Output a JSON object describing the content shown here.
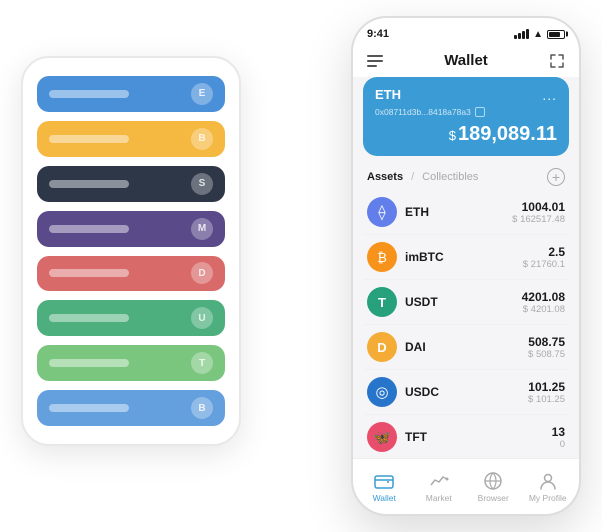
{
  "bg_phone": {
    "cards": [
      {
        "color": "card-blue",
        "label": "",
        "icon": "E"
      },
      {
        "color": "card-yellow",
        "label": "",
        "icon": "B"
      },
      {
        "color": "card-dark",
        "label": "",
        "icon": "S"
      },
      {
        "color": "card-purple",
        "label": "",
        "icon": "M"
      },
      {
        "color": "card-red",
        "label": "",
        "icon": "D"
      },
      {
        "color": "card-green",
        "label": "",
        "icon": "U"
      },
      {
        "color": "card-lightgreen",
        "label": "",
        "icon": "T"
      },
      {
        "color": "card-cornblue",
        "label": "",
        "icon": "B"
      }
    ]
  },
  "status_bar": {
    "time": "9:41"
  },
  "header": {
    "title": "Wallet"
  },
  "eth_card": {
    "title": "ETH",
    "address": "0x08711d3b...8418a78a3",
    "dots": "...",
    "currency_symbol": "$",
    "balance": "189,089.11"
  },
  "assets": {
    "tab_active": "Assets",
    "separator": "/",
    "tab_inactive": "Collectibles",
    "add_icon": "+"
  },
  "tokens": [
    {
      "name": "ETH",
      "icon": "⟠",
      "icon_class": "icon-eth",
      "amount": "1004.01",
      "usd": "$ 162517.48"
    },
    {
      "name": "imBTC",
      "icon": "₿",
      "icon_class": "icon-imbtc",
      "amount": "2.5",
      "usd": "$ 21760.1"
    },
    {
      "name": "USDT",
      "icon": "T",
      "icon_class": "icon-usdt",
      "amount": "4201.08",
      "usd": "$ 4201.08"
    },
    {
      "name": "DAI",
      "icon": "D",
      "icon_class": "icon-dai",
      "amount": "508.75",
      "usd": "$ 508.75"
    },
    {
      "name": "USDC",
      "icon": "◎",
      "icon_class": "icon-usdc",
      "amount": "101.25",
      "usd": "$ 101.25"
    },
    {
      "name": "TFT",
      "icon": "🦋",
      "icon_class": "icon-tft",
      "amount": "13",
      "usd": "0"
    }
  ],
  "bottom_nav": [
    {
      "label": "Wallet",
      "active": true,
      "icon": "wallet"
    },
    {
      "label": "Market",
      "active": false,
      "icon": "market"
    },
    {
      "label": "Browser",
      "active": false,
      "icon": "browser"
    },
    {
      "label": "My Profile",
      "active": false,
      "icon": "profile"
    }
  ]
}
